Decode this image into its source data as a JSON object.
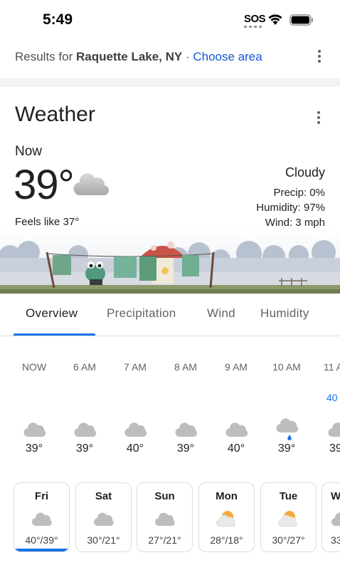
{
  "status_bar": {
    "time": "5:49",
    "sos": "SOS"
  },
  "results": {
    "prefix": "Results for ",
    "location": "Raquette Lake, NY",
    "separator": " · ",
    "link": "Choose area"
  },
  "weather": {
    "title": "Weather",
    "now_label": "Now",
    "temperature": "39°",
    "feels_like": "Feels like 37°",
    "condition": "Cloudy",
    "precip": "Precip: 0%",
    "humidity": "Humidity: 97%",
    "wind": "Wind: 3 mph",
    "icon": "cloud-icon"
  },
  "tabs": [
    {
      "label": "Overview",
      "active": true
    },
    {
      "label": "Precipitation",
      "active": false
    },
    {
      "label": "Wind",
      "active": false
    },
    {
      "label": "Humidity",
      "active": false
    }
  ],
  "hourly": [
    {
      "time": "NOW",
      "temp": "39°",
      "icon": "cloud-icon",
      "extra": ""
    },
    {
      "time": "6 AM",
      "temp": "39°",
      "icon": "cloud-icon",
      "extra": ""
    },
    {
      "time": "7 AM",
      "temp": "40°",
      "icon": "cloud-icon",
      "extra": ""
    },
    {
      "time": "8 AM",
      "temp": "39°",
      "icon": "cloud-icon",
      "extra": ""
    },
    {
      "time": "9 AM",
      "temp": "40°",
      "icon": "cloud-icon",
      "extra": ""
    },
    {
      "time": "10 AM",
      "temp": "39°",
      "icon": "rain-cloud-icon",
      "extra": ""
    },
    {
      "time": "11 A",
      "temp": "39",
      "icon": "cloud-icon",
      "extra": "40"
    }
  ],
  "daily": [
    {
      "day": "Fri",
      "range": "40°/39°",
      "icon": "cloud-icon",
      "selected": true
    },
    {
      "day": "Sat",
      "range": "30°/21°",
      "icon": "cloud-icon",
      "selected": false
    },
    {
      "day": "Sun",
      "range": "27°/21°",
      "icon": "cloud-icon",
      "selected": false
    },
    {
      "day": "Mon",
      "range": "28°/18°",
      "icon": "partly-sunny-icon",
      "selected": false
    },
    {
      "day": "Tue",
      "range": "30°/27°",
      "icon": "partly-sunny-icon",
      "selected": false
    },
    {
      "day": "W",
      "range": "33",
      "icon": "cloud-icon",
      "selected": false
    }
  ],
  "colors": {
    "accent": "#1a73e8",
    "link": "#1558d6",
    "cloud": "#bdbdbd",
    "sun": "#f4a93a"
  }
}
